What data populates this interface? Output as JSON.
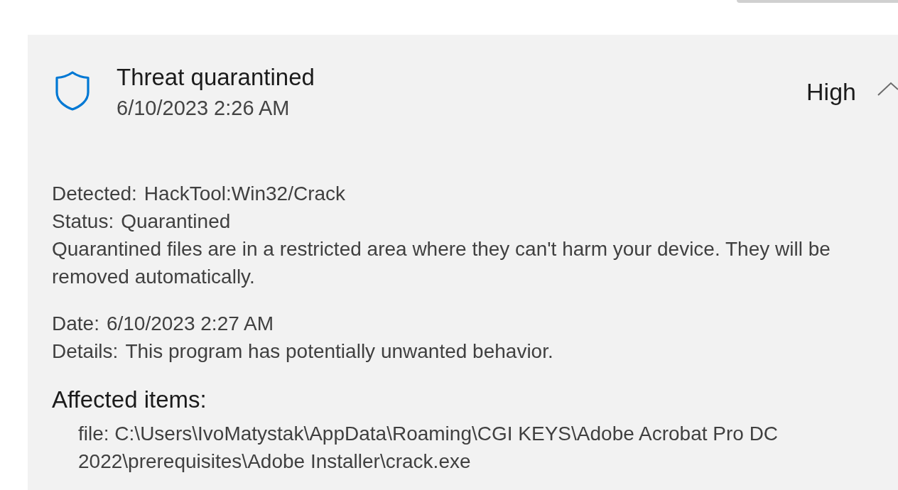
{
  "threat": {
    "title": "Threat quarantined",
    "timestamp": "6/10/2023 2:26 AM",
    "severity": "High",
    "expanded": true
  },
  "details": [
    {
      "label": "Detected:",
      "value": "HackTool:Win32/Crack"
    },
    {
      "label": "Status:",
      "value": "Quarantined"
    }
  ],
  "status_note": "Quarantined files are in a restricted area where they can't harm your device. They will be removed automatically.",
  "more_details": [
    {
      "label": "Date:",
      "value": "6/10/2023 2:27 AM"
    },
    {
      "label": "Details:",
      "value": "This program has potentially unwanted behavior."
    }
  ],
  "affected_items": {
    "heading": "Affected items:",
    "items": [
      "file: C:\\Users\\IvoMatystak\\AppData\\Roaming\\CGI KEYS\\Adobe Acrobat Pro DC 2022\\prerequisites\\Adobe Installer\\crack.exe"
    ]
  }
}
